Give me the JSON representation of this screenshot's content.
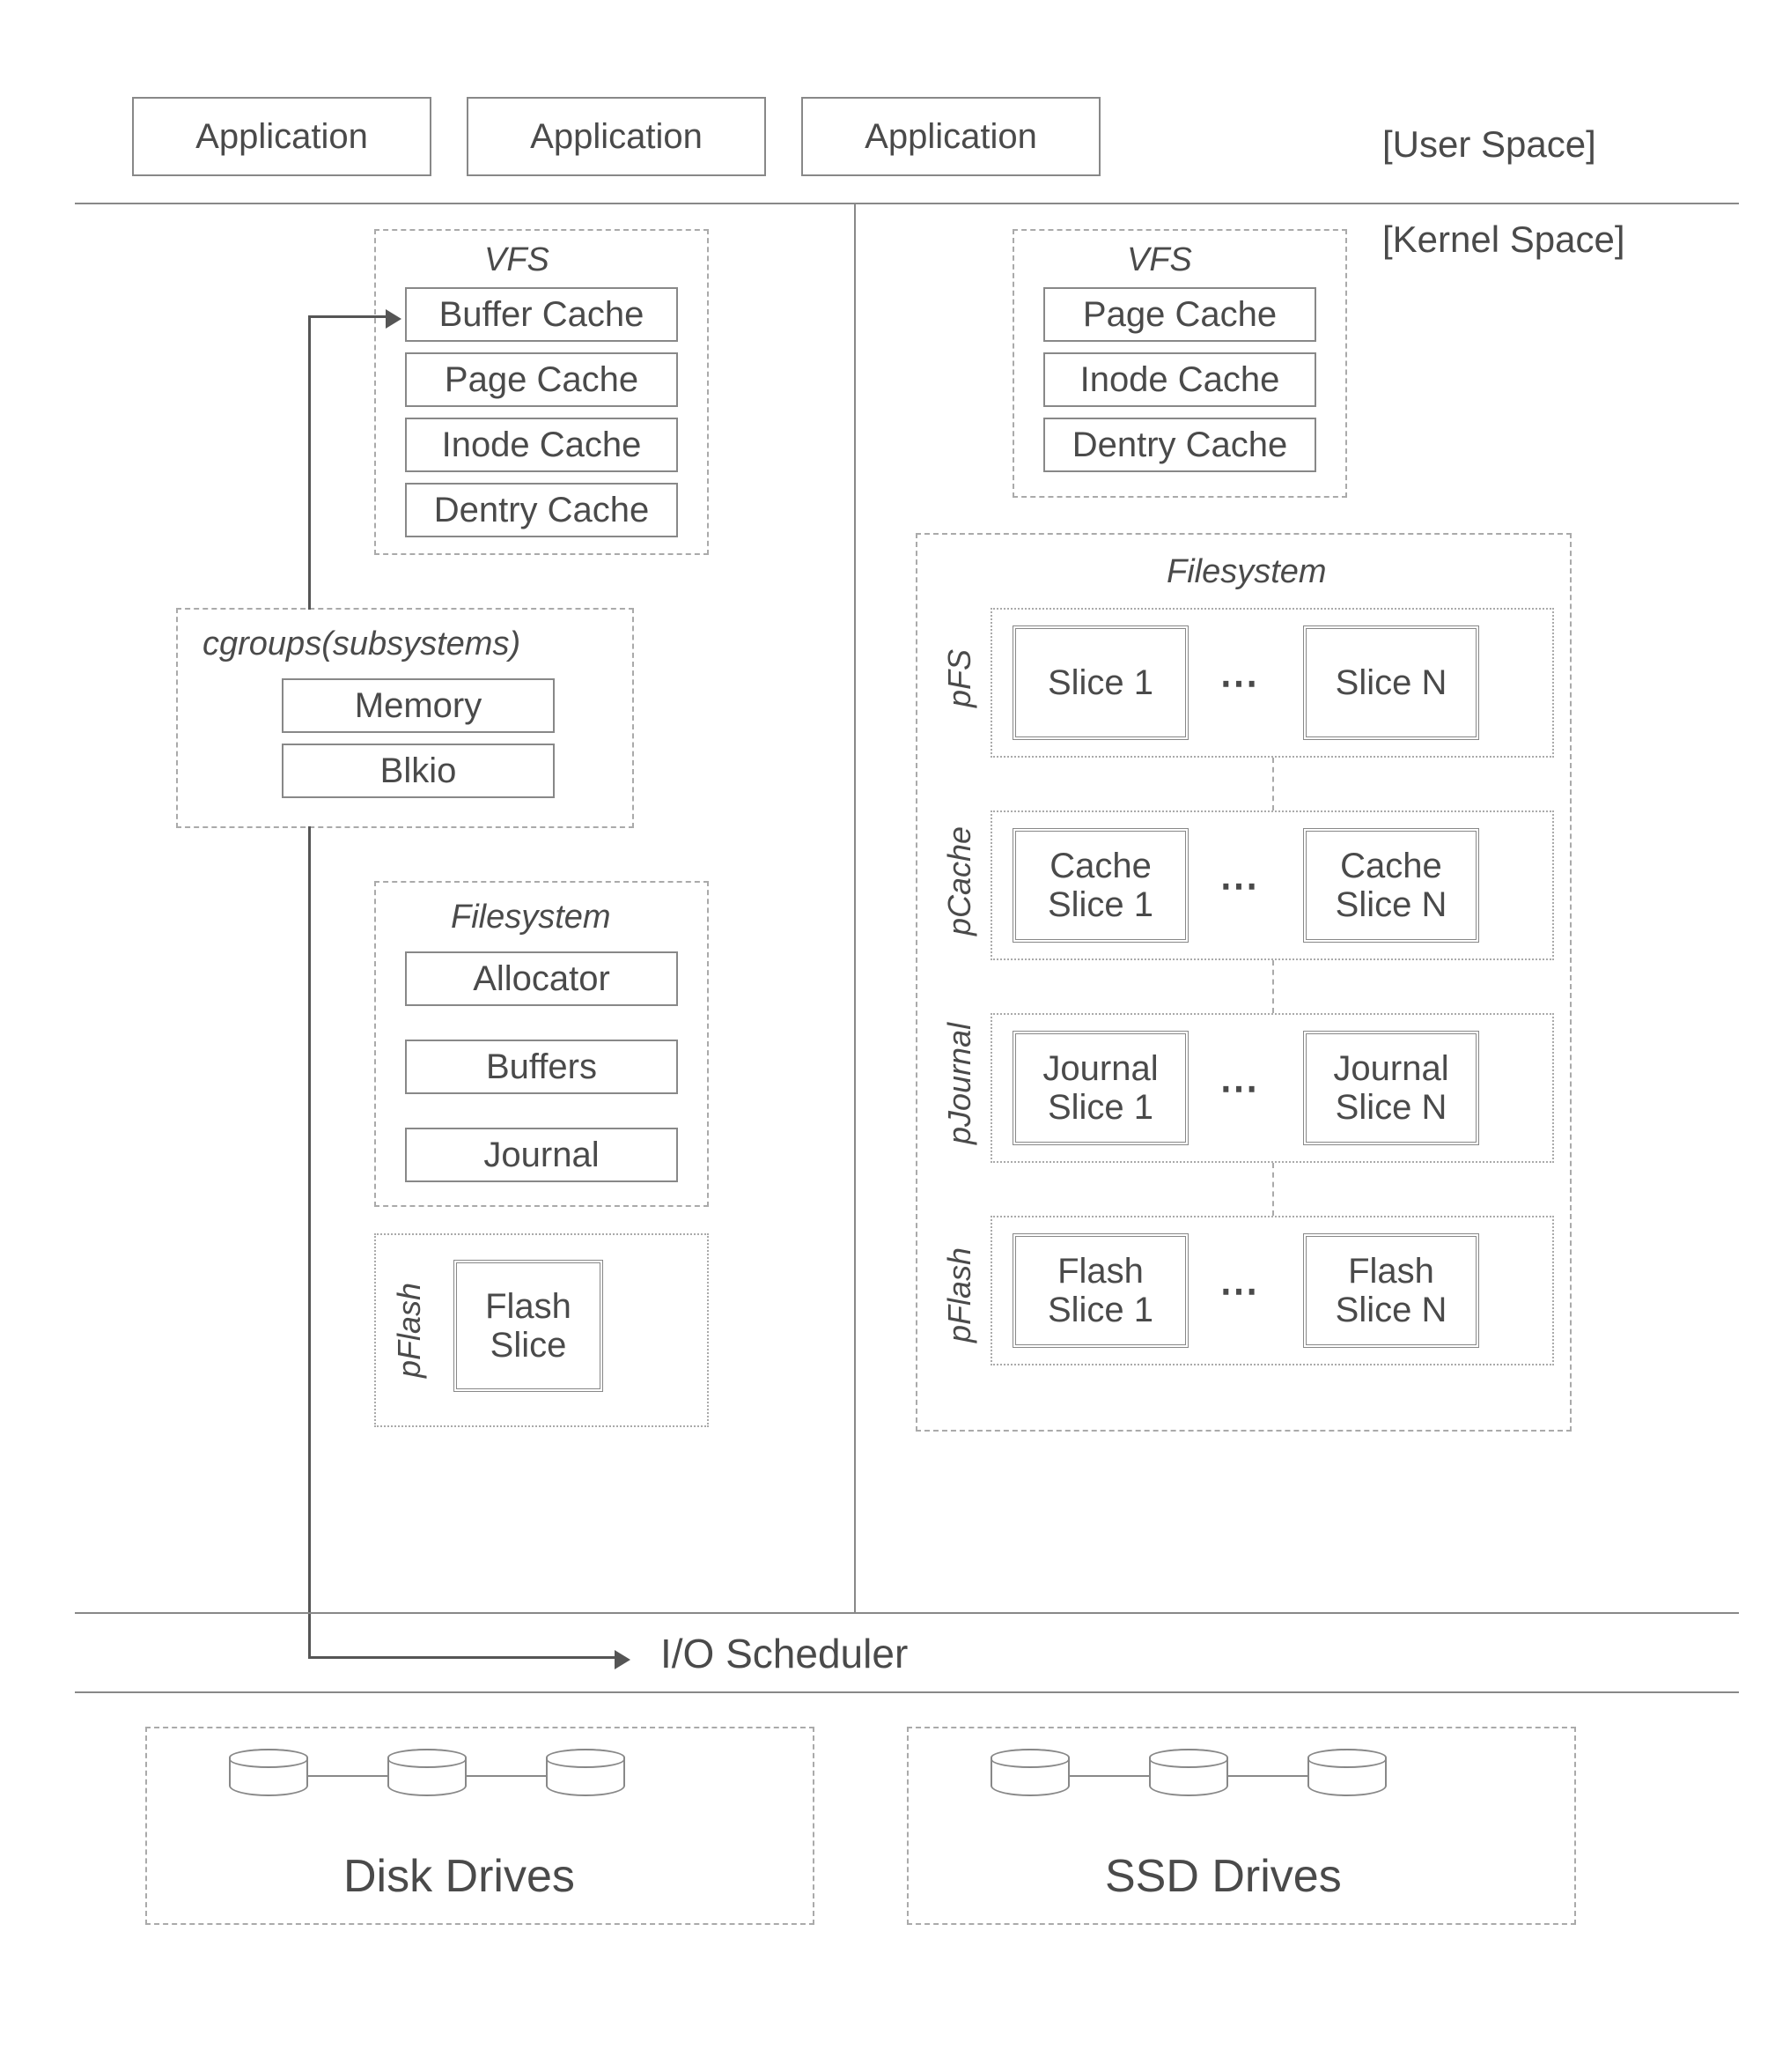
{
  "header": {
    "app1": "Application",
    "app2": "Application",
    "app3": "Application",
    "userSpace": "[User Space]",
    "kernelSpace": "[Kernel Space]"
  },
  "left": {
    "vfsTitle": "VFS",
    "vfsItems": [
      "Buffer Cache",
      "Page Cache",
      "Inode Cache",
      "Dentry Cache"
    ],
    "cgroupsTitle": "cgroups(subsystems)",
    "cgroupsItems": [
      "Memory",
      "Blkio"
    ],
    "fsTitle": "Filesystem",
    "fsItems": [
      "Allocator",
      "Buffers",
      "Journal"
    ],
    "pFlashTitle": "pFlash",
    "pFlashSlice": "Flash\nSlice"
  },
  "right": {
    "vfsTitle": "VFS",
    "vfsItems": [
      "Page Cache",
      "Inode Cache",
      "Dentry Cache"
    ],
    "fsTitle": "Filesystem",
    "rows": [
      {
        "title": "pFS",
        "a": "Slice 1",
        "b": "Slice N"
      },
      {
        "title": "pCache",
        "a": "Cache\nSlice 1",
        "b": "Cache\nSlice N"
      },
      {
        "title": "pJournal",
        "a": "Journal\nSlice 1",
        "b": "Journal\nSlice N"
      },
      {
        "title": "pFlash",
        "a": "Flash\nSlice 1",
        "b": "Flash\nSlice N"
      }
    ],
    "dots": "⋯"
  },
  "bottom": {
    "ioScheduler": "I/O Scheduler",
    "disk": "Disk Drives",
    "ssd": "SSD Drives"
  }
}
